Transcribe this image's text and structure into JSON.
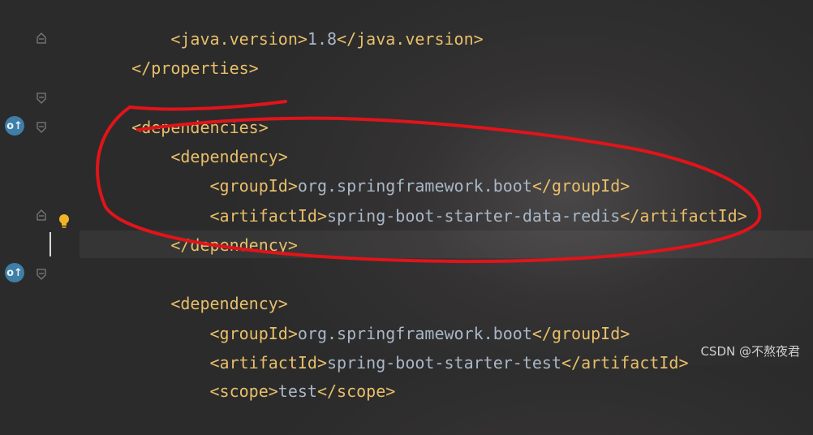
{
  "lines": [
    {
      "indent": "    ",
      "tag1": "<java.version>",
      "text": "1.8",
      "tag2": "</java.version>"
    },
    {
      "indent": "",
      "tag1": "</properties>",
      "text": "",
      "tag2": ""
    },
    {
      "indent": "",
      "tag1": "",
      "text": "",
      "tag2": ""
    },
    {
      "indent": "",
      "tag1": "<dependencies>",
      "text": "",
      "tag2": ""
    },
    {
      "indent": "    ",
      "tag1": "<dependency>",
      "text": "",
      "tag2": ""
    },
    {
      "indent": "        ",
      "tag1": "<groupId>",
      "text": "org.springframework.boot",
      "tag2": "</groupId>"
    },
    {
      "indent": "        ",
      "tag1": "<artifactId>",
      "text": "spring-boot-starter-data-redis",
      "tag2": "</artifactId>"
    },
    {
      "indent": "    ",
      "tag1": "</dependency>",
      "text": "",
      "tag2": ""
    },
    {
      "indent": "",
      "tag1": "",
      "text": "",
      "tag2": ""
    },
    {
      "indent": "    ",
      "tag1": "<dependency>",
      "text": "",
      "tag2": ""
    },
    {
      "indent": "        ",
      "tag1": "<groupId>",
      "text": "org.springframework.boot",
      "tag2": "</groupId>"
    },
    {
      "indent": "        ",
      "tag1": "<artifactId>",
      "text": "spring-boot-starter-test",
      "tag2": "</artifactId>"
    },
    {
      "indent": "        ",
      "tag1": "<scope>",
      "text": "test",
      "tag2": "</scope>"
    }
  ],
  "gutter": {
    "implementation_badge_glyph": "o↑",
    "fold_icon": "fold-marker-icon",
    "intention_icon": "lightbulb-icon"
  },
  "watermark": "CSDN @不熬夜君",
  "colors": {
    "tag": "#e8bf6a",
    "text": "#a9b7c6",
    "annotation": "#e0141a",
    "badge": "#3f7ea6"
  }
}
